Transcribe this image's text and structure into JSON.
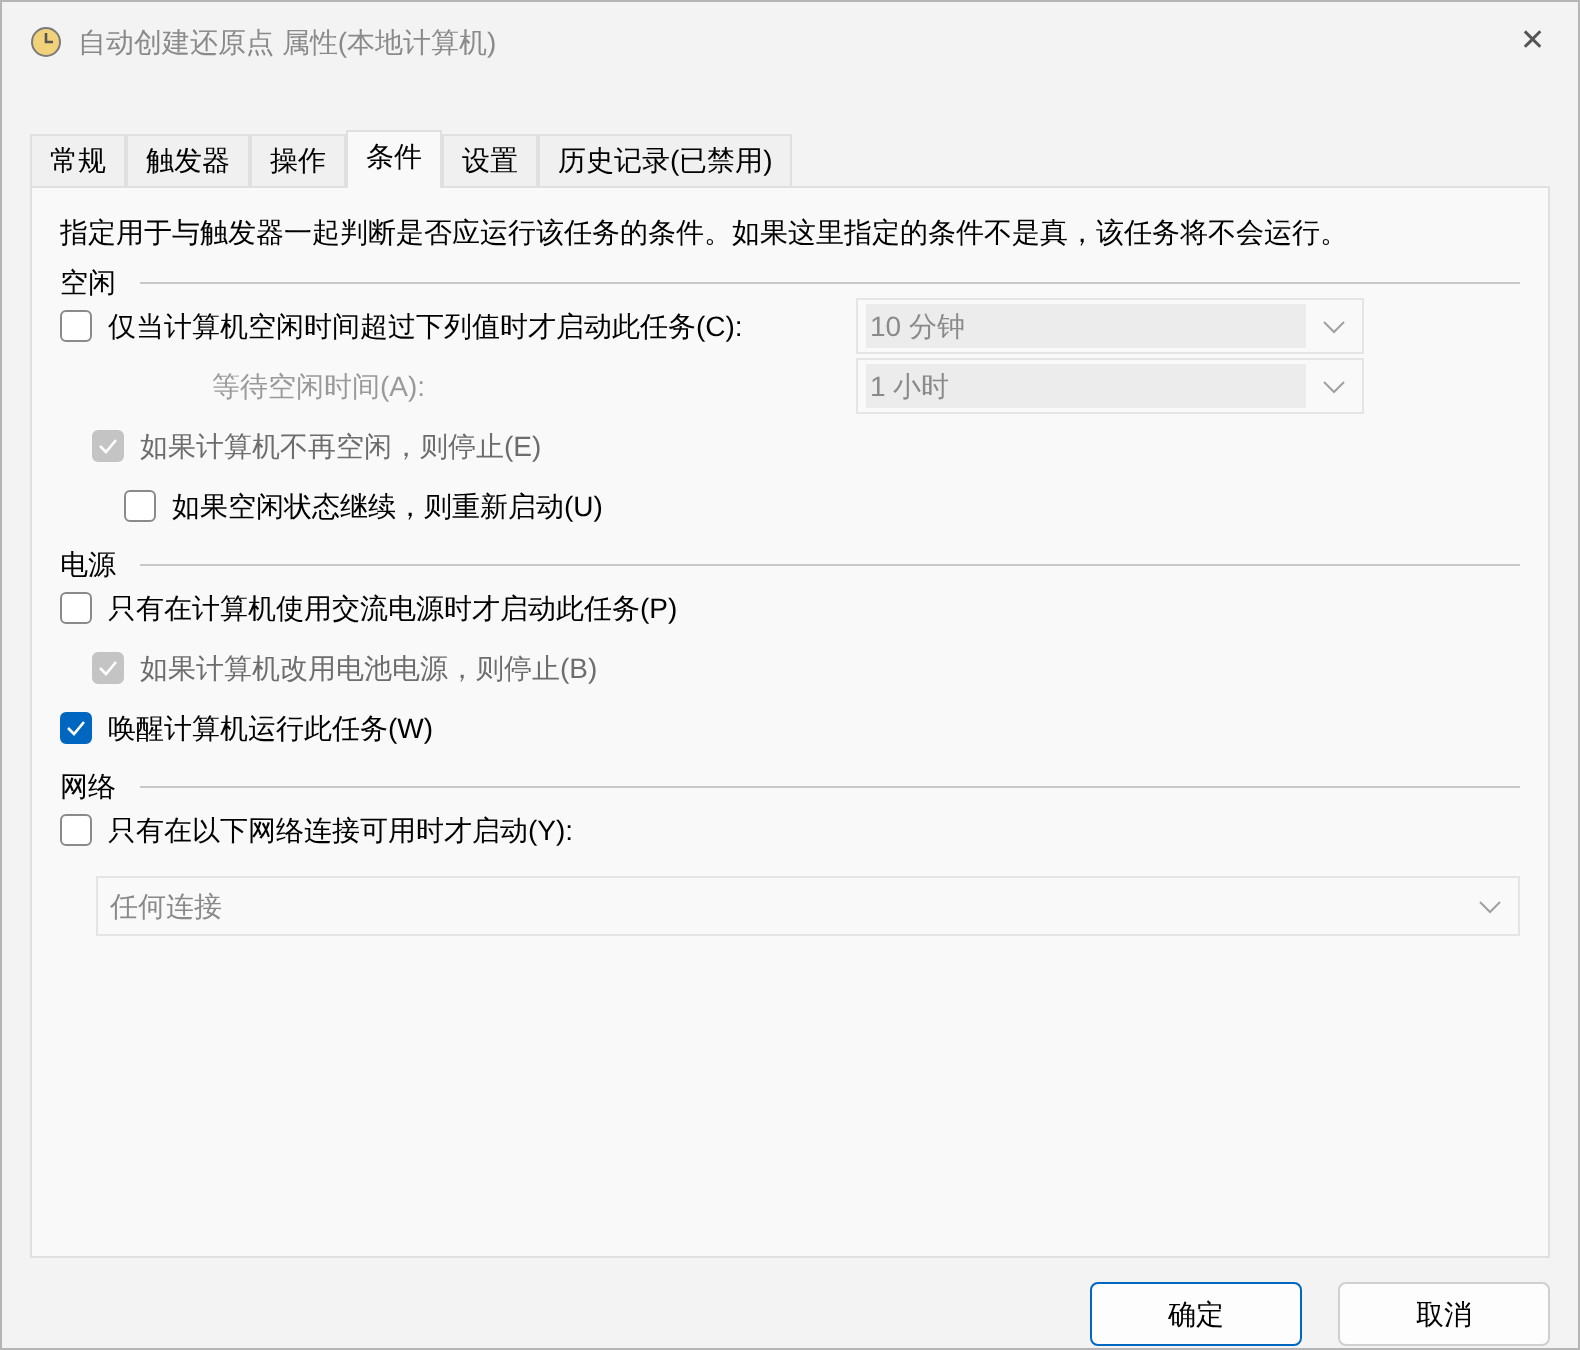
{
  "window": {
    "title": "自动创建还原点 属性(本地计算机)",
    "close": "✕"
  },
  "tabs": [
    {
      "label": "常规",
      "selected": false
    },
    {
      "label": "触发器",
      "selected": false
    },
    {
      "label": "操作",
      "selected": false
    },
    {
      "label": "条件",
      "selected": true
    },
    {
      "label": "设置",
      "selected": false
    },
    {
      "label": "历史记录(已禁用)",
      "selected": false
    }
  ],
  "description": "指定用于与触发器一起判断是否应运行该任务的条件。如果这里指定的条件不是真，该任务将不会运行。",
  "sections": [
    {
      "title": "空闲",
      "items": [
        {
          "kind": "checkbox",
          "label": "仅当计算机空闲时间超过下列值时才启动此任务(C):",
          "checked": false,
          "disabled": false,
          "dropdown": {
            "value": "10 分钟",
            "disabled": true
          },
          "fields": [
            {
              "label": "等待空闲时间(A):",
              "value": "1 小时",
              "disabled": true
            }
          ],
          "children": [
            {
              "kind": "checkbox",
              "label": "如果计算机不再空闲，则停止(E)",
              "checked": true,
              "disabled": true,
              "children": [
                {
                  "kind": "checkbox",
                  "label": "如果空闲状态继续，则重新启动(U)",
                  "checked": false,
                  "disabled": false
                }
              ]
            }
          ]
        }
      ]
    },
    {
      "title": "电源",
      "items": [
        {
          "kind": "checkbox",
          "label": "只有在计算机使用交流电源时才启动此任务(P)",
          "checked": false,
          "disabled": false,
          "children": [
            {
              "kind": "checkbox",
              "label": "如果计算机改用电池电源，则停止(B)",
              "checked": true,
              "disabled": true
            }
          ]
        },
        {
          "kind": "checkbox",
          "label": "唤醒计算机运行此任务(W)",
          "checked": true,
          "disabled": false
        }
      ]
    },
    {
      "title": "网络",
      "items": [
        {
          "kind": "checkbox",
          "label": "只有在以下网络连接可用时才启动(Y):",
          "checked": false,
          "disabled": false
        },
        {
          "kind": "dropdown",
          "value": "任何连接",
          "disabled": true
        }
      ]
    }
  ],
  "buttons": [
    {
      "label": "确定",
      "selected": true
    },
    {
      "label": "取消",
      "selected": false
    }
  ]
}
